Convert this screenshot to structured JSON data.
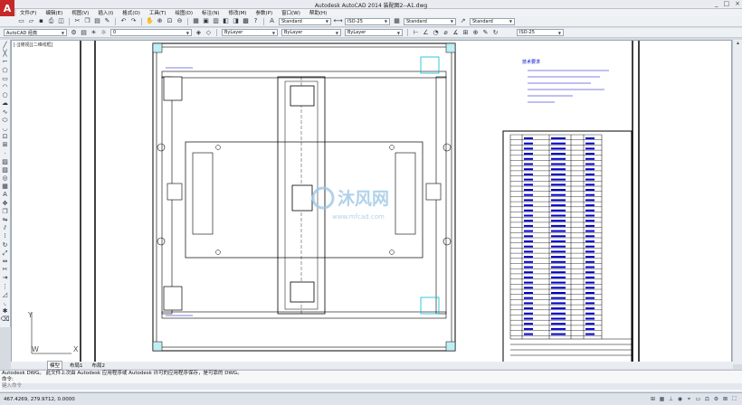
{
  "window": {
    "title": "Autodesk AutoCAD 2014   装配图2--A1.dwg",
    "app_letter": "A",
    "controls": [
      "_",
      "□",
      "×"
    ]
  },
  "menu": [
    "文件(F)",
    "编辑(E)",
    "视图(V)",
    "插入(I)",
    "格式(O)",
    "工具(T)",
    "绘图(D)",
    "标注(N)",
    "修改(M)",
    "参数(P)",
    "窗口(W)",
    "帮助(H)"
  ],
  "toolbar1": {
    "text_style": "Standard",
    "dim_style": "ISO-25",
    "table_style": "Standard",
    "mleader_style": "Standard"
  },
  "toolbar2": {
    "workspace": "AutoCAD 经典",
    "layer": "0",
    "color": "ByLayer",
    "linetype": "ByLayer",
    "lineweight": "ByLayer",
    "dim_style_right": "ISO-25"
  },
  "viewport_label": "[-][俯视][二维线框]",
  "layout_tabs": {
    "model": "模型",
    "layout1": "布局1",
    "layout2": "布局2"
  },
  "command": {
    "history": "Autodesk DWG。 此文件上次由 Autodesk 应用程序或 Autodesk 许可的应用程序保存，是可靠的 DWG。",
    "prompt": "命令:",
    "input_placeholder": "键入命令"
  },
  "status": {
    "coords": "467.4269, 279.9712, 0.0000"
  },
  "ucs": {
    "y": "Y",
    "x": "X",
    "w": "W"
  },
  "drawing": {
    "watermark_cn": "沐风网",
    "watermark_url": "www.mfcad.com",
    "notes_title": "技术要求"
  },
  "colors": {
    "bg": "#ffffff",
    "drawing_line": "#000000",
    "annotation": "#0000cc",
    "accent_cyan": "#00bcd4",
    "watermark": "#9ec7e5"
  }
}
